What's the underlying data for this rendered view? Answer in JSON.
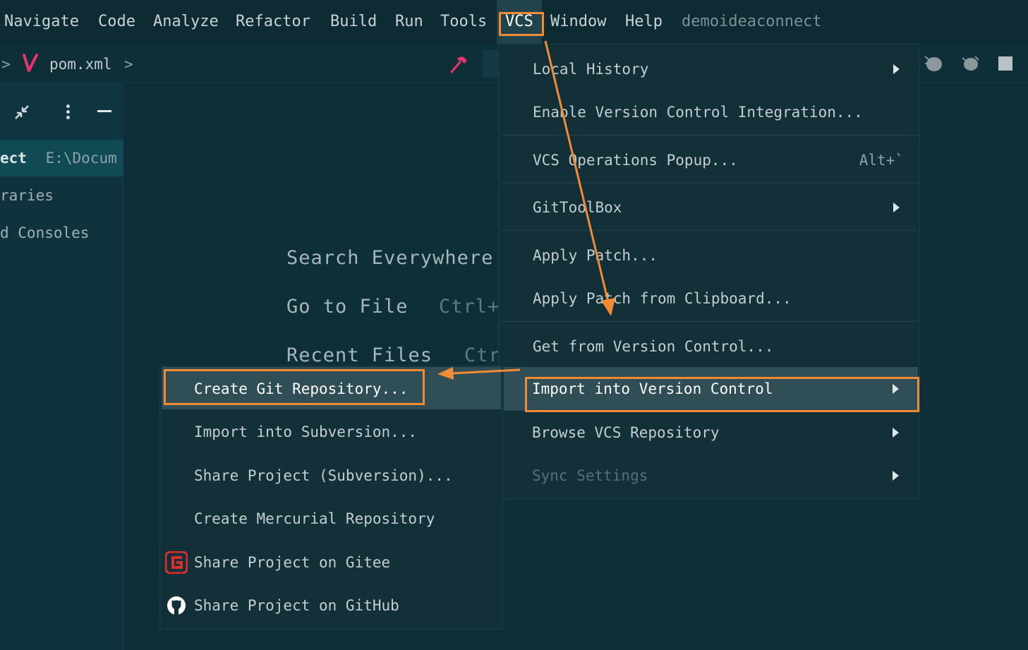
{
  "menubar": {
    "items": [
      "Navigate",
      "Code",
      "Analyze",
      "Refactor",
      "Build",
      "Run",
      "Tools",
      "VCS",
      "Window",
      "Help"
    ],
    "project_name": "demoideaconnect"
  },
  "toolbar": {
    "breadcrumb_file": "pom.xml"
  },
  "sidebar": {
    "project_label": "ect",
    "project_path": "E:\\Docum",
    "libraries": "raries",
    "consoles": "d Consoles"
  },
  "editor_hints": {
    "search": "Search Everywhere",
    "goto_file": "Go to File",
    "goto_file_shortcut": "Ctrl+",
    "recent": "Recent Files",
    "recent_shortcut": "Ctr"
  },
  "vcs_menu": {
    "local_history": "Local History",
    "enable_vci": "Enable Version Control Integration...",
    "ops_popup": "VCS Operations Popup...",
    "ops_popup_shortcut": "Alt+`",
    "gittoolbox": "GitToolBox",
    "apply_patch": "Apply Patch...",
    "apply_patch_clip": "Apply Patch from Clipboard...",
    "get_from_vc": "Get from Version Control...",
    "import_vc": "Import into Version Control",
    "browse_repo": "Browse VCS Repository",
    "sync_settings": "Sync Settings"
  },
  "import_submenu": {
    "create_git": "Create Git Repository...",
    "import_svn": "Import into Subversion...",
    "share_svn": "Share Project (Subversion)...",
    "create_hg": "Create Mercurial Repository",
    "share_gitee": "Share Project on Gitee",
    "share_github": "Share Project on GitHub"
  },
  "colors": {
    "highlight": "#f28c34",
    "background": "#0e2e38",
    "popup": "#132f38"
  }
}
